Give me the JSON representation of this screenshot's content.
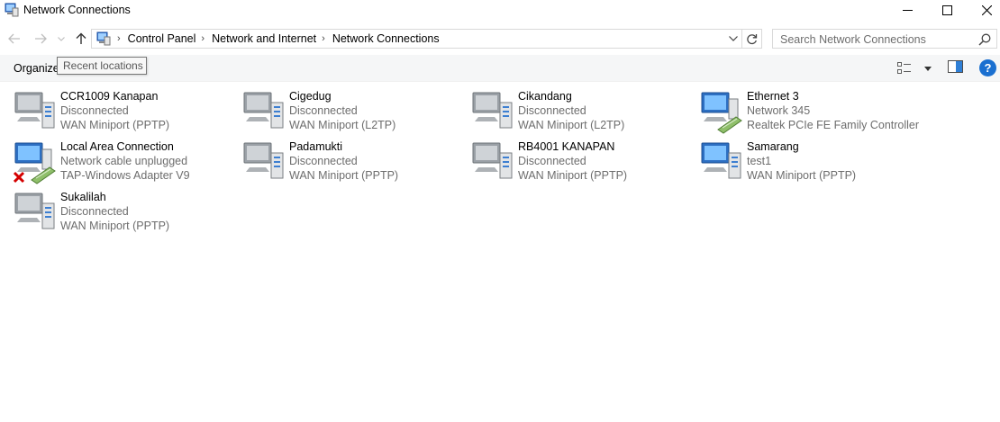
{
  "window": {
    "title": "Network Connections",
    "minimize_glyph": "—",
    "close_glyph": "✕"
  },
  "address": {
    "crumbs": [
      "Control Panel",
      "Network and Internet",
      "Network Connections"
    ],
    "search_placeholder": "Search Network Connections"
  },
  "toolbar": {
    "organize_label": "Organize",
    "tooltip": "Recent locations",
    "help_label": "?"
  },
  "connections": [
    {
      "name": "CCR1009 Kanapan",
      "status": "Disconnected",
      "device": "WAN Miniport (PPTP)",
      "icon": "vpn-connection-icon"
    },
    {
      "name": "Cigedug",
      "status": "Disconnected",
      "device": "WAN Miniport (L2TP)",
      "icon": "vpn-connection-icon"
    },
    {
      "name": "Cikandang",
      "status": "Disconnected",
      "device": "WAN Miniport (L2TP)",
      "icon": "vpn-connection-icon"
    },
    {
      "name": "Ethernet 3",
      "status": "Network 345",
      "device": "Realtek PCIe FE Family Controller",
      "icon": "ethernet-connection-icon"
    },
    {
      "name": "Local Area Connection",
      "status": "Network cable unplugged",
      "device": "TAP-Windows Adapter V9",
      "icon": "ethernet-unplugged-icon"
    },
    {
      "name": "Padamukti",
      "status": "Disconnected",
      "device": "WAN Miniport (PPTP)",
      "icon": "vpn-connection-icon"
    },
    {
      "name": "RB4001 KANAPAN",
      "status": "Disconnected",
      "device": "WAN Miniport (PPTP)",
      "icon": "vpn-connection-icon"
    },
    {
      "name": "Samarang",
      "status": "test1",
      "device": "WAN Miniport (PPTP)",
      "icon": "vpn-connected-icon"
    },
    {
      "name": "Sukalilah",
      "status": "Disconnected",
      "device": "WAN Miniport (PPTP)",
      "icon": "vpn-connection-icon"
    }
  ],
  "colors": {
    "accent": "#1a6fd0",
    "secondary_text": "#6d6d6d",
    "error_red": "#d40000"
  }
}
